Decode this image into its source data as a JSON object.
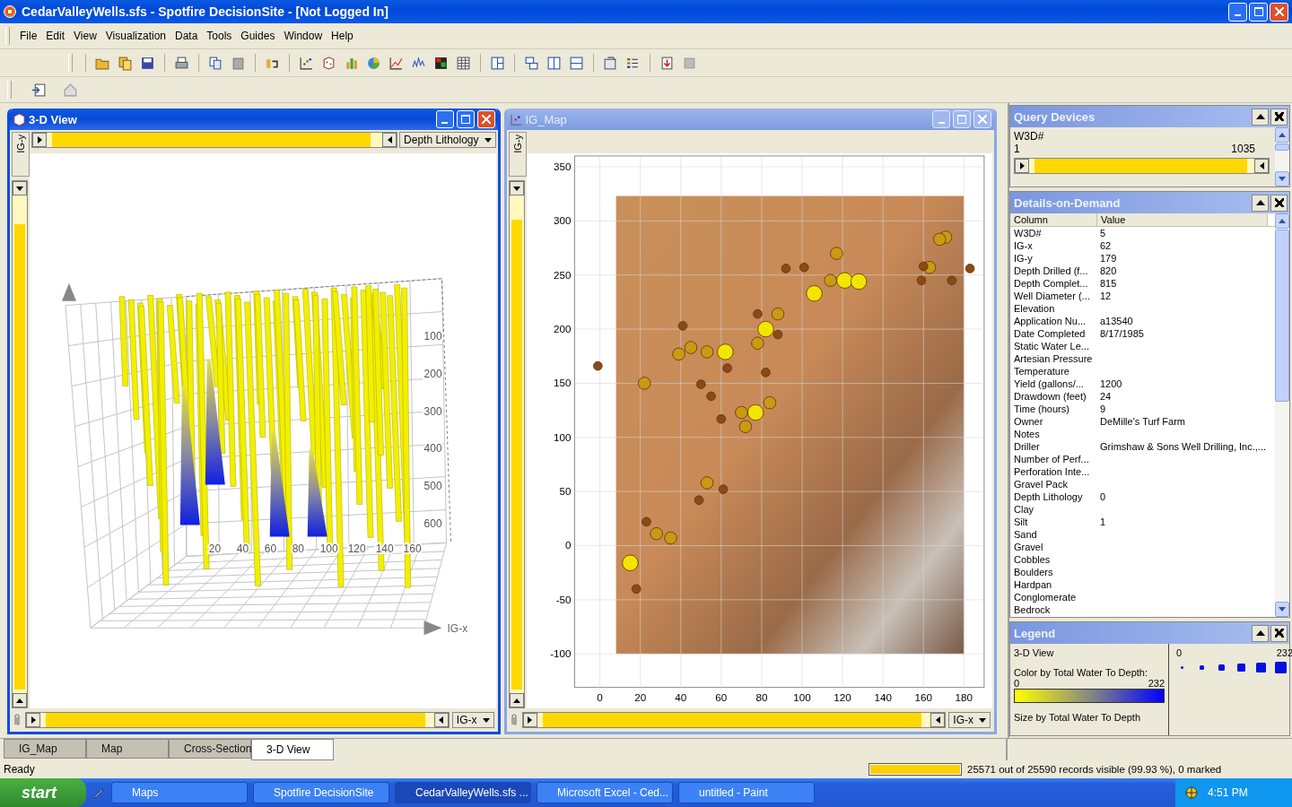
{
  "window": {
    "title": "CedarValleyWells.sfs - Spotfire DecisionSite - [Not Logged In]"
  },
  "menu": [
    "File",
    "Edit",
    "View",
    "Visualization",
    "Data",
    "Tools",
    "Guides",
    "Window",
    "Help"
  ],
  "children": [
    {
      "kind": "scene",
      "title": "3-D View",
      "active": true,
      "y_axis": "IG-y",
      "x_axis": "IG-x",
      "color_column": "Depth Lithology",
      "top_slider": {
        "level": 0.98
      },
      "side_slider": {
        "level": 0.97
      },
      "bottom_slider": {
        "level": 0.99
      },
      "depth_ticks": [
        "100",
        "200",
        "300",
        "400",
        "500",
        "600"
      ],
      "x_ticks": [
        "20",
        "40",
        "60",
        "80",
        "100",
        "120",
        "140",
        "160"
      ],
      "axis_label": "IG-x"
    },
    {
      "kind": "map",
      "title": "IG_Map",
      "active": false,
      "y_axis": "IG-y",
      "x_axis": "IG-x",
      "side_slider": {
        "level": 0.98
      },
      "bottom_slider": {
        "level": 0.99
      },
      "chart_data": {
        "type": "scatter",
        "grid": true,
        "xlim": [
          -12.5,
          190
        ],
        "ylim": [
          -131,
          360
        ],
        "xticks": [
          0,
          20,
          40,
          60,
          80,
          100,
          120,
          140,
          160,
          180
        ],
        "yticks": [
          -100,
          -50,
          0,
          50,
          100,
          150,
          200,
          250,
          300,
          350
        ],
        "series": [
          {
            "color": "#f2e600",
            "x": [
              62,
              106,
              15,
              82,
              77,
              121,
              128
            ],
            "values": [
              179,
              233,
              -16,
              200,
              123,
              245,
              244
            ]
          },
          {
            "color": "#c99a12",
            "x": [
              22,
              28,
              35,
              53,
              70,
              39,
              45,
              53,
              88,
              117,
              114,
              171,
              168,
              163,
              72,
              84,
              78
            ],
            "values": [
              150,
              11,
              7,
              58,
              123,
              177,
              183,
              179,
              214,
              270,
              245,
              285,
              283,
              257,
              110,
              132,
              187
            ]
          },
          {
            "color": "#8b4a14",
            "x": [
              -1,
              18,
              23,
              61,
              49,
              63,
              60,
              78,
              101,
              92,
              183,
              159,
              174,
              160,
              41,
              88,
              82,
              50,
              55
            ],
            "values": [
              166,
              -40,
              22,
              52,
              42,
              164,
              117,
              214,
              257,
              256,
              256,
              245,
              245,
              258,
              203,
              195,
              160,
              149,
              138
            ]
          }
        ]
      }
    }
  ],
  "query_devices": {
    "title": "Query Devices",
    "label": "W3D#",
    "min": "1",
    "max": "1035",
    "level": 0.99
  },
  "details": {
    "title": "Details-on-Demand",
    "columns": [
      "Column",
      "Value"
    ],
    "rows": [
      {
        "column": "W3D#",
        "value": "5"
      },
      {
        "column": "IG-x",
        "value": "62"
      },
      {
        "column": "IG-y",
        "value": "179"
      },
      {
        "column": "Depth Drilled (f...",
        "value": "820"
      },
      {
        "column": "Depth Complet...",
        "value": "815"
      },
      {
        "column": "Well Diameter (...",
        "value": "12"
      },
      {
        "column": "Elevation"
      },
      {
        "column": "Application Nu...",
        "value": "a13540"
      },
      {
        "column": "Date Completed",
        "value": "8/17/1985"
      },
      {
        "column": "Static Water Le..."
      },
      {
        "column": "Artesian Pressure"
      },
      {
        "column": "Temperature"
      },
      {
        "column": "Yield (gallons/...",
        "value": "1200"
      },
      {
        "column": "Drawdown (feet)",
        "value": "24"
      },
      {
        "column": "Time (hours)",
        "value": "9"
      },
      {
        "column": "Owner",
        "value": "DeMille's Turf Farm"
      },
      {
        "column": "Notes"
      },
      {
        "column": "Driller",
        "value": "Grimshaw & Sons Well Drilling, Inc.,..."
      },
      {
        "column": "Number of Perf..."
      },
      {
        "column": "Perforation Inte..."
      },
      {
        "column": "Gravel Pack"
      },
      {
        "column": "Depth Lithology",
        "value": "0"
      },
      {
        "column": "Clay"
      },
      {
        "column": "Silt",
        "value": "1"
      },
      {
        "column": "Sand"
      },
      {
        "column": "Gravel"
      },
      {
        "column": "Cobbles"
      },
      {
        "column": "Boulders"
      },
      {
        "column": "Hardpan"
      },
      {
        "column": "Conglomerate"
      },
      {
        "column": "Bedrock"
      }
    ]
  },
  "legend": {
    "title": "Legend",
    "view": "3-D View",
    "color_by": "Color by Total Water To Depth:",
    "color_min": "0",
    "color_max": "232",
    "size_by": "Size by Total Water To Depth",
    "size_min": "0",
    "size_max": "232"
  },
  "tabs": [
    {
      "label": "IG_Map",
      "selected": false
    },
    {
      "label": "Map",
      "selected": false
    },
    {
      "label": "Cross-Section",
      "selected": false
    },
    {
      "label": "3-D View",
      "selected": true
    }
  ],
  "status": {
    "text": "Ready",
    "level": 0.9993,
    "records": "25571 out of 25590 records visible (99.93 %), 0 marked"
  },
  "taskbar": {
    "start": "start",
    "items": [
      {
        "label": "Maps",
        "selected": false
      },
      {
        "label": "Spotfire DecisionSite",
        "selected": false
      },
      {
        "label": "CedarValleyWells.sfs ...",
        "selected": true
      },
      {
        "label": "Microsoft Excel - Ced...",
        "selected": false
      },
      {
        "label": "untitled - Paint",
        "selected": false
      }
    ],
    "clock": "4:51 PM"
  }
}
